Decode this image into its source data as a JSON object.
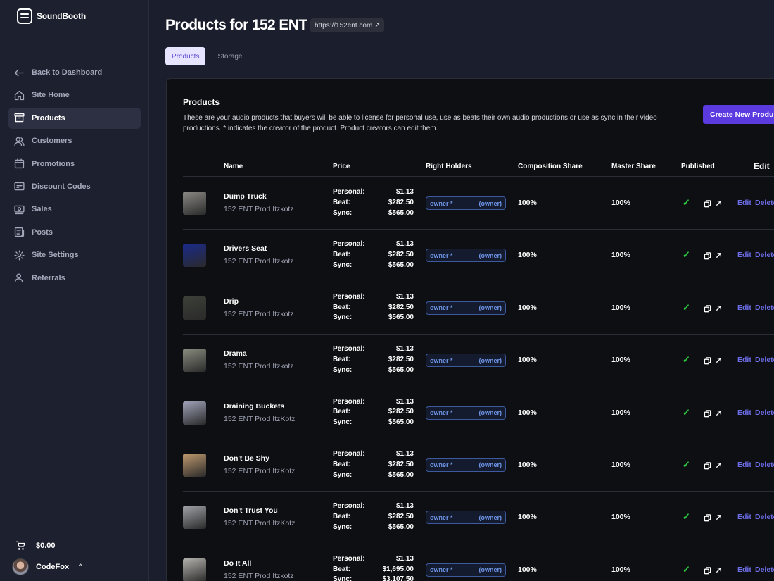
{
  "app": {
    "name": "SoundBooth"
  },
  "sidebar": {
    "items": [
      {
        "label": "Back to Dashboard",
        "icon": "arrow-left-icon"
      },
      {
        "label": "Site Home",
        "icon": "home-icon"
      },
      {
        "label": "Products",
        "icon": "archive-box-icon",
        "active": true
      },
      {
        "label": "Customers",
        "icon": "users-icon"
      },
      {
        "label": "Promotions",
        "icon": "calendar-icon"
      },
      {
        "label": "Discount Codes",
        "icon": "ticket-icon"
      },
      {
        "label": "Sales",
        "icon": "cash-icon"
      },
      {
        "label": "Posts",
        "icon": "newspaper-icon"
      },
      {
        "label": "Site Settings",
        "icon": "gear-icon"
      },
      {
        "label": "Referrals",
        "icon": "user-group-icon"
      }
    ],
    "cart_total": "$0.00",
    "user_name": "CodeFox"
  },
  "header": {
    "title": "Products for 152 ENT",
    "url": "https://152ent.com ↗"
  },
  "tabs": [
    {
      "label": "Products",
      "active": true
    },
    {
      "label": "Storage",
      "active": false
    }
  ],
  "section": {
    "title": "Products",
    "description": "These are your audio products that buyers will be able to license for personal use, use as beats their own audio productions or use as sync in their video productions. * indicates the creator of the product. Product creators can edit them.",
    "create_button": "Create New Product"
  },
  "table": {
    "headers": {
      "name": "Name",
      "price": "Price",
      "right_holders": "Right Holders",
      "composition_share": "Composition Share",
      "master_share": "Master Share",
      "published": "Published",
      "edit": "Edit"
    },
    "price_labels": {
      "personal": "Personal:",
      "beat": "Beat:",
      "sync": "Sync:"
    },
    "rows": [
      {
        "name": "Dump Truck",
        "creator": "152 ENT Prod Itzkotz",
        "personal": "$1.13",
        "beat": "$282.50",
        "sync": "$565.00",
        "holder": "owner *",
        "role": "(owner)",
        "composition": "100%",
        "master": "100%",
        "published": "✓",
        "edit": "Edit",
        "delete": "Delete",
        "thumb_color": "#8c8a86"
      },
      {
        "name": "Drivers Seat",
        "creator": "152 ENT Prod Itzkotz",
        "personal": "$1.13",
        "beat": "$282.50",
        "sync": "$565.00",
        "holder": "owner *",
        "role": "(owner)",
        "composition": "100%",
        "master": "100%",
        "published": "✓",
        "edit": "Edit",
        "delete": "Delete",
        "thumb_color": "#1a2a8c"
      },
      {
        "name": "Drip",
        "creator": "152 ENT Prod Itzkotz",
        "personal": "$1.13",
        "beat": "$282.50",
        "sync": "$565.00",
        "holder": "owner *",
        "role": "(owner)",
        "composition": "100%",
        "master": "100%",
        "published": "✓",
        "edit": "Edit",
        "delete": "Delete",
        "thumb_color": "#3d4038"
      },
      {
        "name": "Drama",
        "creator": "152 ENT Prod Itzkotz",
        "personal": "$1.13",
        "beat": "$282.50",
        "sync": "$565.00",
        "holder": "owner *",
        "role": "(owner)",
        "composition": "100%",
        "master": "100%",
        "published": "✓",
        "edit": "Edit",
        "delete": "Delete",
        "thumb_color": "#8a8d80"
      },
      {
        "name": "Draining Buckets",
        "creator": "152 ENT Prod ItzKotz",
        "personal": "$1.13",
        "beat": "$282.50",
        "sync": "$565.00",
        "holder": "owner *",
        "role": "(owner)",
        "composition": "100%",
        "master": "100%",
        "published": "✓",
        "edit": "Edit",
        "delete": "Delete",
        "thumb_color": "#9fa2b8"
      },
      {
        "name": "Don't Be Shy",
        "creator": "152 ENT Prod ItzKotz",
        "personal": "$1.13",
        "beat": "$282.50",
        "sync": "$565.00",
        "holder": "owner *",
        "role": "(owner)",
        "composition": "100%",
        "master": "100%",
        "published": "✓",
        "edit": "Edit",
        "delete": "Delete",
        "thumb_color": "#c09a6e"
      },
      {
        "name": "Don't Trust You",
        "creator": "152 ENT Prod ItzKotz",
        "personal": "$1.13",
        "beat": "$282.50",
        "sync": "$565.00",
        "holder": "owner *",
        "role": "(owner)",
        "composition": "100%",
        "master": "100%",
        "published": "✓",
        "edit": "Edit",
        "delete": "Delete",
        "thumb_color": "#a0a3a8"
      },
      {
        "name": "Do It All",
        "creator": "152 ENT Prod Itzkotz",
        "personal": "$1.13",
        "beat": "$1,695.00",
        "sync": "$3,107.50",
        "holder": "owner *",
        "role": "(owner)",
        "composition": "100%",
        "master": "100%",
        "published": "✓",
        "edit": "Edit",
        "delete": "Delete",
        "thumb_color": "#b4b2ae"
      }
    ]
  }
}
